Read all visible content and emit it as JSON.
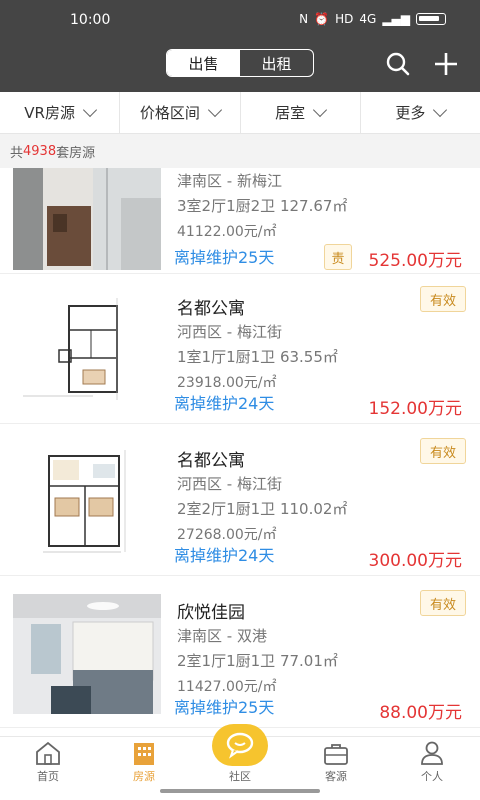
{
  "status_bar": {
    "time": "10:00",
    "network_label": "4G"
  },
  "header": {
    "tabs": [
      {
        "label": "出售",
        "active": true
      },
      {
        "label": "出租",
        "active": false
      }
    ],
    "search_icon": "search-icon",
    "add_icon": "plus-icon"
  },
  "filters": [
    {
      "label": "VR房源"
    },
    {
      "label": "价格区间"
    },
    {
      "label": "居室"
    },
    {
      "label": "更多"
    }
  ],
  "count": {
    "prefix": "共",
    "value": "4938",
    "suffix": "套房源"
  },
  "listings": [
    {
      "title": "",
      "location": "津南区 - 新梅江",
      "layout": "3室2厅1厨2卫   127.67㎡",
      "unit_price": "41122.00元/㎡",
      "maintenance": "离掉维护25天",
      "badge": "责",
      "price": "525.00万元"
    },
    {
      "title": "名都公寓",
      "location": "河西区 - 梅江街",
      "layout": "1室1厅1厨1卫   63.55㎡",
      "unit_price": "23918.00元/㎡",
      "maintenance": "离掉维护24天",
      "badge": "有效",
      "price": "152.00万元"
    },
    {
      "title": "名都公寓",
      "location": "河西区 - 梅江街",
      "layout": "2室2厅1厨1卫   110.02㎡",
      "unit_price": "27268.00元/㎡",
      "maintenance": "离掉维护24天",
      "badge": "有效",
      "price": "300.00万元"
    },
    {
      "title": "欣悦佳园",
      "location": "津南区 - 双港",
      "layout": "2室1厅1厨1卫   77.01㎡",
      "unit_price": "11427.00元/㎡",
      "maintenance": "离掉维护25天",
      "badge": "有效",
      "price": "88.00万元"
    }
  ],
  "bottom_nav": [
    {
      "label": "首页",
      "icon": "home-icon",
      "active": false
    },
    {
      "label": "房源",
      "icon": "building-icon",
      "active": true
    },
    {
      "label": "社区",
      "icon": "chat-bubble-icon",
      "active": false
    },
    {
      "label": "客源",
      "icon": "briefcase-icon",
      "active": false
    },
    {
      "label": "个人",
      "icon": "person-icon",
      "active": false
    }
  ],
  "colors": {
    "header_bg": "#454545",
    "accent_red": "#e43535",
    "accent_blue": "#2f8de4",
    "nav_active": "#e8a23a",
    "fab": "#f6c42e"
  }
}
